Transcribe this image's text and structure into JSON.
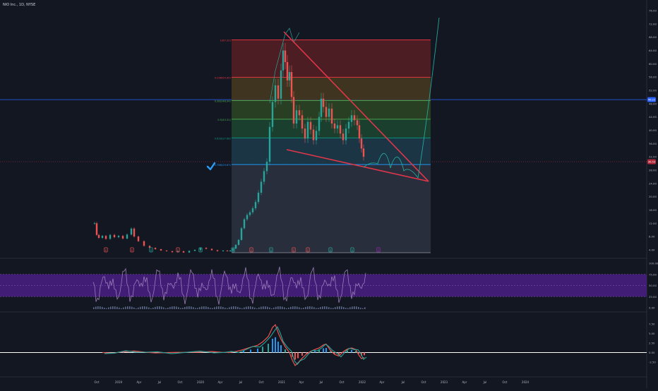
{
  "header": {
    "symbol_title": "NIO Inc., 1D, NYSE"
  },
  "colors": {
    "background": "#131722",
    "up": "#26a69a",
    "down": "#ef5350",
    "wedge": "#e0364a",
    "projection": "#26a69a",
    "price_line": "#2962ff",
    "rsi_band": "#4a1e84",
    "rsi_line": "#9c7cb9",
    "macd_line": "#2196f3",
    "macd_signal": "#ff6d00",
    "check": "#2a9df4",
    "fib_0": "#f23645",
    "fib_236": "#f23645",
    "fib_382": "#4caf50",
    "fib_5": "#4caf50",
    "fib_618": "#089981",
    "fib_786": "#2196f3",
    "fib_1": "#787b86"
  },
  "price_axis": {
    "labels": [
      "76.00",
      "72.00",
      "68.00",
      "64.00",
      "60.00",
      "56.00",
      "52.00",
      "48.00",
      "44.00",
      "40.00",
      "36.00",
      "32.00",
      "28.00",
      "24.00",
      "20.00",
      "16.00",
      "12.00",
      "8.00",
      "4.00"
    ],
    "current_price_badge": "49.22",
    "second_price_badge": "30.53"
  },
  "rsi_axis": {
    "labels": [
      "100.00",
      "75.00",
      "50.00",
      "25.00",
      "0.00"
    ]
  },
  "macd_axis": {
    "labels": [
      "7.50",
      "5.00",
      "2.50",
      "0.00",
      "-2.50"
    ]
  },
  "time_axis": {
    "labels": [
      "Oct",
      "2019",
      "Apr",
      "Jul",
      "Oct",
      "2020",
      "Apr",
      "Jul",
      "Oct",
      "2021",
      "Apr",
      "Jul",
      "Oct",
      "2022",
      "Apr",
      "Jul",
      "Oct",
      "2023",
      "Apr",
      "Jul",
      "Oct",
      "2024"
    ]
  },
  "fib_levels": [
    {
      "label": "1(67.20)",
      "price": 67.2,
      "color_key": "fib_0"
    },
    {
      "label": "0.236(55.95)",
      "price": 55.95,
      "color_key": "fib_236"
    },
    {
      "label": "0.382(48.94)",
      "price": 48.94,
      "color_key": "fib_382"
    },
    {
      "label": "0.5(43.31)",
      "price": 43.31,
      "color_key": "fib_5"
    },
    {
      "label": "0.618(37.68)",
      "price": 37.68,
      "color_key": "fib_618"
    },
    {
      "label": "0.786(29.67)",
      "price": 29.67,
      "color_key": "fib_786"
    }
  ],
  "event_markers": [
    {
      "label": "E",
      "kind": "earnings"
    },
    {
      "label": "E",
      "kind": "earnings"
    },
    {
      "label": "D",
      "kind": "dividend"
    },
    {
      "label": "E",
      "kind": "earnings"
    },
    {
      "label": "D",
      "kind": "dividend"
    },
    {
      "label": "D",
      "kind": "dividend"
    },
    {
      "label": "E",
      "kind": "earnings"
    },
    {
      "label": "D",
      "kind": "dividend"
    },
    {
      "label": "E",
      "kind": "earnings"
    },
    {
      "label": "E",
      "kind": "earnings"
    },
    {
      "label": "D",
      "kind": "dividend"
    },
    {
      "label": "D",
      "kind": "dividend"
    },
    {
      "label": "S",
      "kind": "split"
    }
  ]
}
